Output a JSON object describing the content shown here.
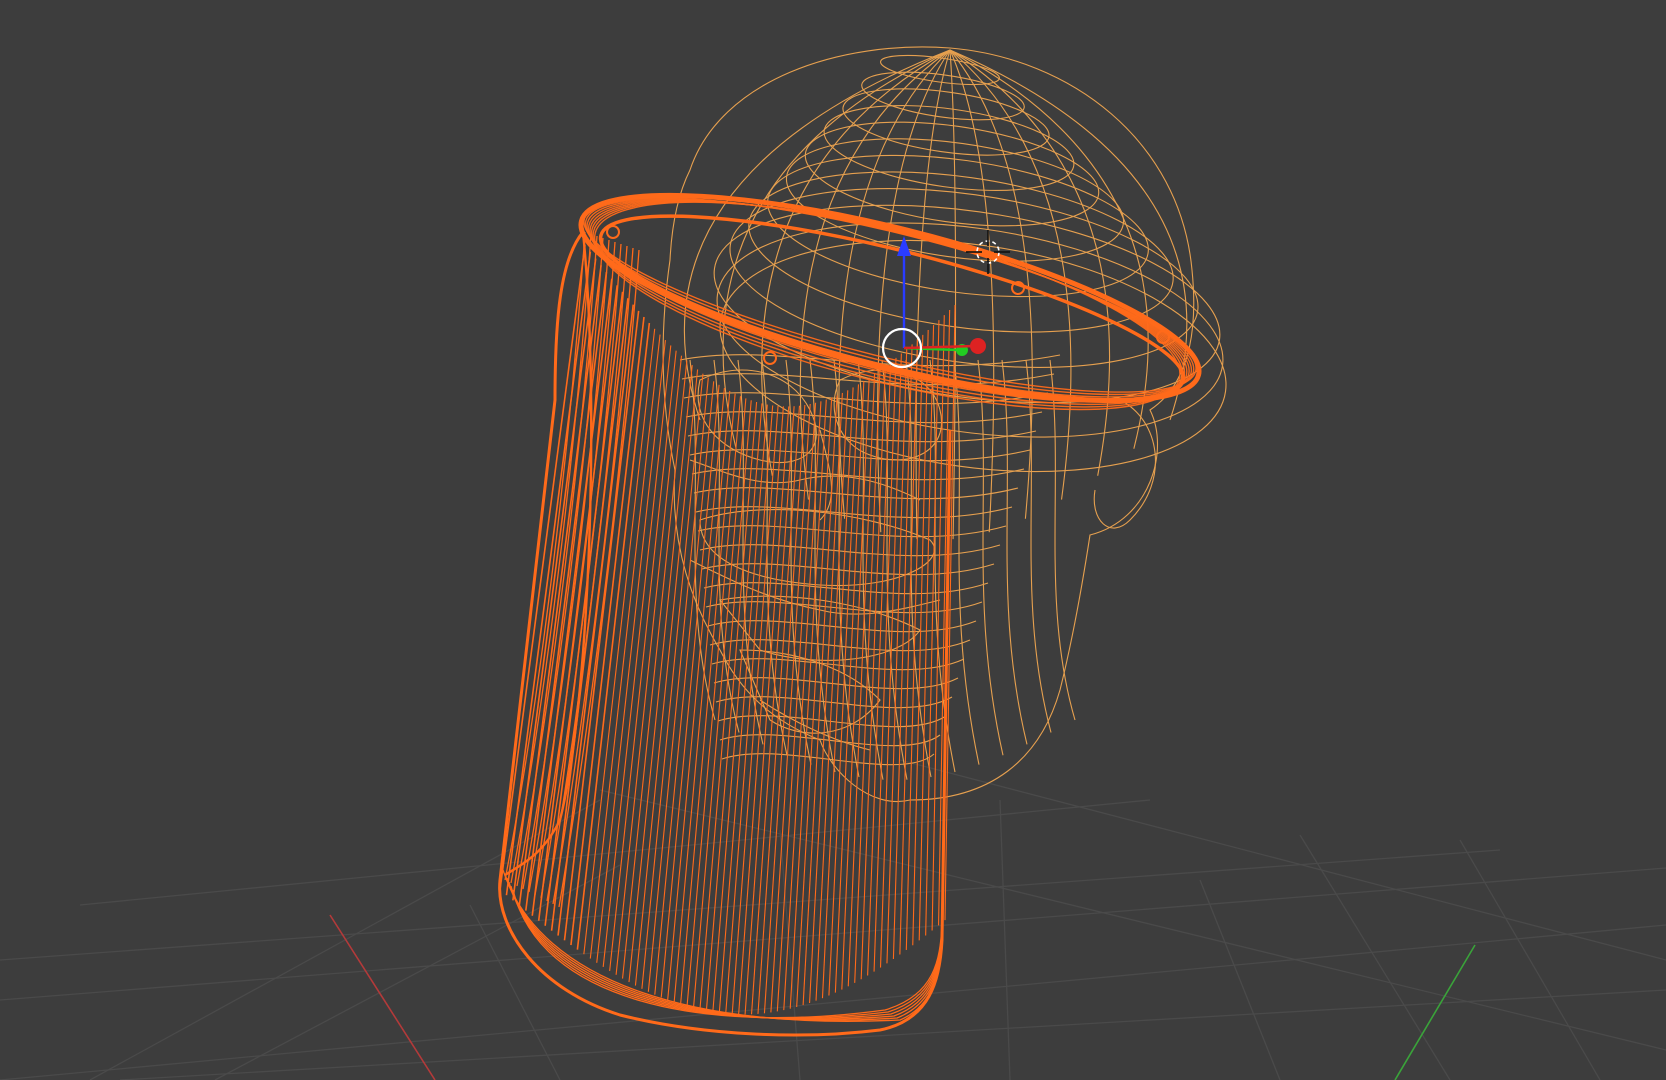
{
  "viewport": {
    "mode": "wireframe",
    "background_color": "#3d3d3d",
    "grid_color": "#4a4a4a",
    "x_axis_color": "#b33a3a",
    "y_axis_color": "#3aa33a"
  },
  "objects": [
    {
      "name": "face-shield",
      "selected": true,
      "color": "#ff6a1a"
    },
    {
      "name": "head",
      "selected": true,
      "color": "#f0a650"
    }
  ],
  "gizmo": {
    "icon": "transform-gizmo",
    "z_color": "#2a3cff",
    "y_color": "#22cc22",
    "x_color": "#dd2222"
  },
  "cursor": {
    "icon": "3d-cursor-icon"
  }
}
